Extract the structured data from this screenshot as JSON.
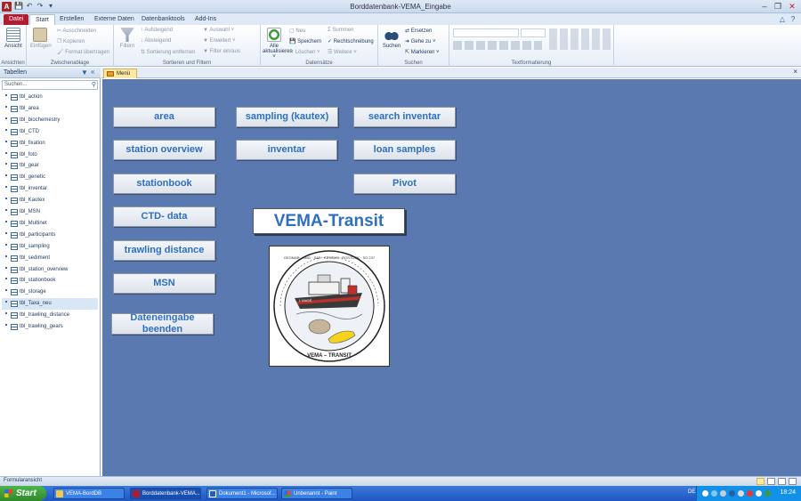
{
  "window": {
    "title": "Borddatenbank-VEMA_Eingabe",
    "app_icon": "A"
  },
  "ribbon_tabs": [
    {
      "label": "Datei"
    },
    {
      "label": "Start"
    },
    {
      "label": "Erstellen"
    },
    {
      "label": "Externe Daten"
    },
    {
      "label": "Datenbanktools"
    },
    {
      "label": "Add-Ins"
    }
  ],
  "ribbon": {
    "ansichten": {
      "label": "Ansichten",
      "ansicht": "Ansicht"
    },
    "zwischenablage": {
      "label": "Zwischenablage",
      "einfuegen": "Einfügen",
      "ausschneiden": "Ausschneiden",
      "kopieren": "Kopieren",
      "format": "Format übertragen"
    },
    "sortieren": {
      "label": "Sortieren und Filtern",
      "filtern": "Filtern",
      "aufsteigend": "Aufsteigend",
      "absteigend": "Absteigend",
      "entfernen": "Sortierung entfernen",
      "auswahl": "Auswahl ˅",
      "erweitert": "Erweitert ˅",
      "filter": "Filter ein/aus"
    },
    "datensaetze": {
      "label": "Datensätze",
      "alle": "Alle",
      "aktualisieren": "aktualisieren ˅",
      "neu": "Neu",
      "speichern": "Speichern",
      "loeschen": "Löschen ˅",
      "summen": "Summen",
      "rechtschreibung": "Rechtschreibung",
      "weitere": "Weitere ˅"
    },
    "suchen": {
      "label": "Suchen",
      "suchen": "Suchen",
      "ersetzen": "Ersetzen",
      "gehe_zu": "Gehe zu ˅",
      "markieren": "Markieren ˅"
    },
    "text": {
      "label": "Textformatierung"
    }
  },
  "nav": {
    "title": "Tabellen",
    "search_placeholder": "Suchen...",
    "items": [
      "tbl_action",
      "tbl_area",
      "tbl_biochemestry",
      "tbl_CTD",
      "tbl_fixation",
      "tbl_foto",
      "tbl_gear",
      "tbl_genetic",
      "tbl_inventar",
      "tbl_Kautex",
      "tbl_MSN",
      "tbl_Multinet",
      "tbl_participants",
      "tbl_sampling",
      "tbl_sediment",
      "tbl_station_overview",
      "tbl_stationbook",
      "tbl_storage",
      "tbl_Taxa_neu",
      "tbl_trawling_distance",
      "tbl_trawling_gears"
    ],
    "selected": "tbl_Taxa_neu"
  },
  "doc_tab": {
    "label": "Menü"
  },
  "form": {
    "buttons": {
      "area": "area",
      "station_overview": "station overview",
      "stationbook": "stationbook",
      "ctd_data": "CTD- data",
      "trawling_distance": "trawling distance",
      "msn": "MSN",
      "end": "Dateneingabe beenden",
      "sampling": "sampling (kautex)",
      "inventar": "inventar",
      "search_inventar": "search inventar",
      "loan_samples": "loan samples",
      "pivot": "Pivot"
    },
    "title": "VEMA-Transit",
    "logo": {
      "ship_label": "L'ANGÉ",
      "bottom_text": "VEMA – TRANSIT",
      "ring_text": "GEOMAR · SNG · SAE · CENSUS · ROSTOCK · SO 237"
    }
  },
  "status": {
    "text": "Formularansicht"
  },
  "taskbar": {
    "start": "Start",
    "tasks": [
      "VEMA-BordDB",
      "Borddatenbank-VEMA...",
      "Dokument1 - Microsof...",
      "Unbenannt - Paint"
    ],
    "lang": "DE",
    "clock": "18:24"
  }
}
